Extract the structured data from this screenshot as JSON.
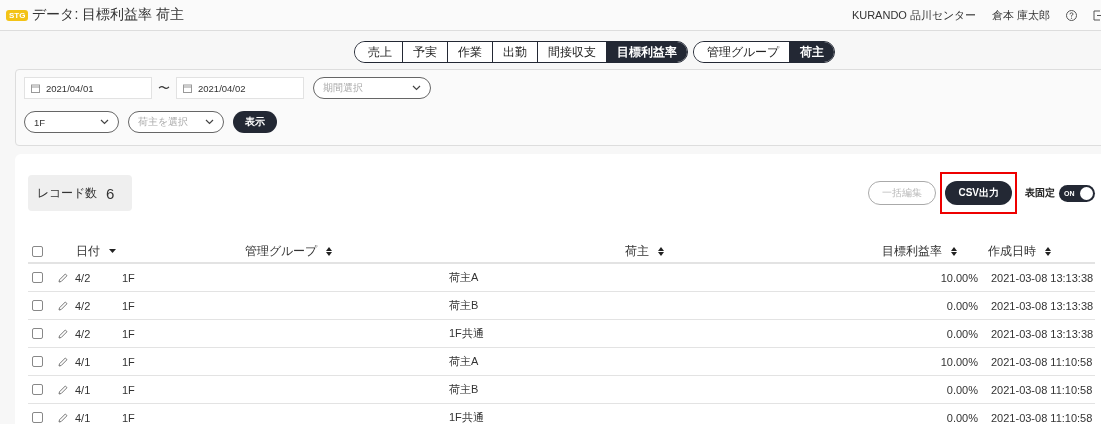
{
  "header": {
    "badge": "STG",
    "title": "データ: 目標利益率 荷主",
    "center": "KURANDO 品川センター",
    "user": "倉本 庫太郎"
  },
  "tab_groups": [
    [
      {
        "label": "売上",
        "selected": false
      },
      {
        "label": "予実",
        "selected": false
      },
      {
        "label": "作業",
        "selected": false
      },
      {
        "label": "出勤",
        "selected": false
      },
      {
        "label": "間接収支",
        "selected": false
      },
      {
        "label": "目標利益率",
        "selected": true
      }
    ],
    [
      {
        "label": "管理グループ",
        "selected": false
      },
      {
        "label": "荷主",
        "selected": true
      }
    ]
  ],
  "filters": {
    "date_from": "2021/04/01",
    "separator": "〜",
    "date_to": "2021/04/02",
    "period": {
      "placeholder": "期間選択"
    },
    "floor": {
      "value": "1F"
    },
    "shipper": {
      "placeholder": "荷主を選択"
    },
    "show_button": "表示"
  },
  "record_count": {
    "label": "レコード数",
    "value": "6"
  },
  "actions": {
    "bulk_edit": {
      "label": "一括編集",
      "disabled": true
    },
    "csv": {
      "label": "CSV出力",
      "highlighted": true
    },
    "fixed": {
      "label": "表固定",
      "on": true,
      "state_label": "ON"
    }
  },
  "table": {
    "all_checked": false,
    "columns": [
      {
        "label": "日付",
        "sorted": true
      },
      {
        "label": "管理グループ",
        "sorted": false
      },
      {
        "label": "荷主",
        "sorted": false
      },
      {
        "label": "目標利益率",
        "sorted": false
      },
      {
        "label": "作成日時",
        "sorted": false
      }
    ],
    "rows": [
      {
        "checked": false,
        "date": "4/2",
        "group": "1F",
        "shipper": "荷主A",
        "rate": "10.00%",
        "created": "2021-03-08 13:13:38"
      },
      {
        "checked": false,
        "date": "4/2",
        "group": "1F",
        "shipper": "荷主B",
        "rate": "0.00%",
        "created": "2021-03-08 13:13:38"
      },
      {
        "checked": false,
        "date": "4/2",
        "group": "1F",
        "shipper": "1F共通",
        "rate": "0.00%",
        "created": "2021-03-08 13:13:38"
      },
      {
        "checked": false,
        "date": "4/1",
        "group": "1F",
        "shipper": "荷主A",
        "rate": "10.00%",
        "created": "2021-03-08 11:10:58"
      },
      {
        "checked": false,
        "date": "4/1",
        "group": "1F",
        "shipper": "荷主B",
        "rate": "0.00%",
        "created": "2021-03-08 11:10:58"
      },
      {
        "checked": false,
        "date": "4/1",
        "group": "1F",
        "shipper": "1F共通",
        "rate": "0.00%",
        "created": "2021-03-08 11:10:58"
      }
    ]
  }
}
